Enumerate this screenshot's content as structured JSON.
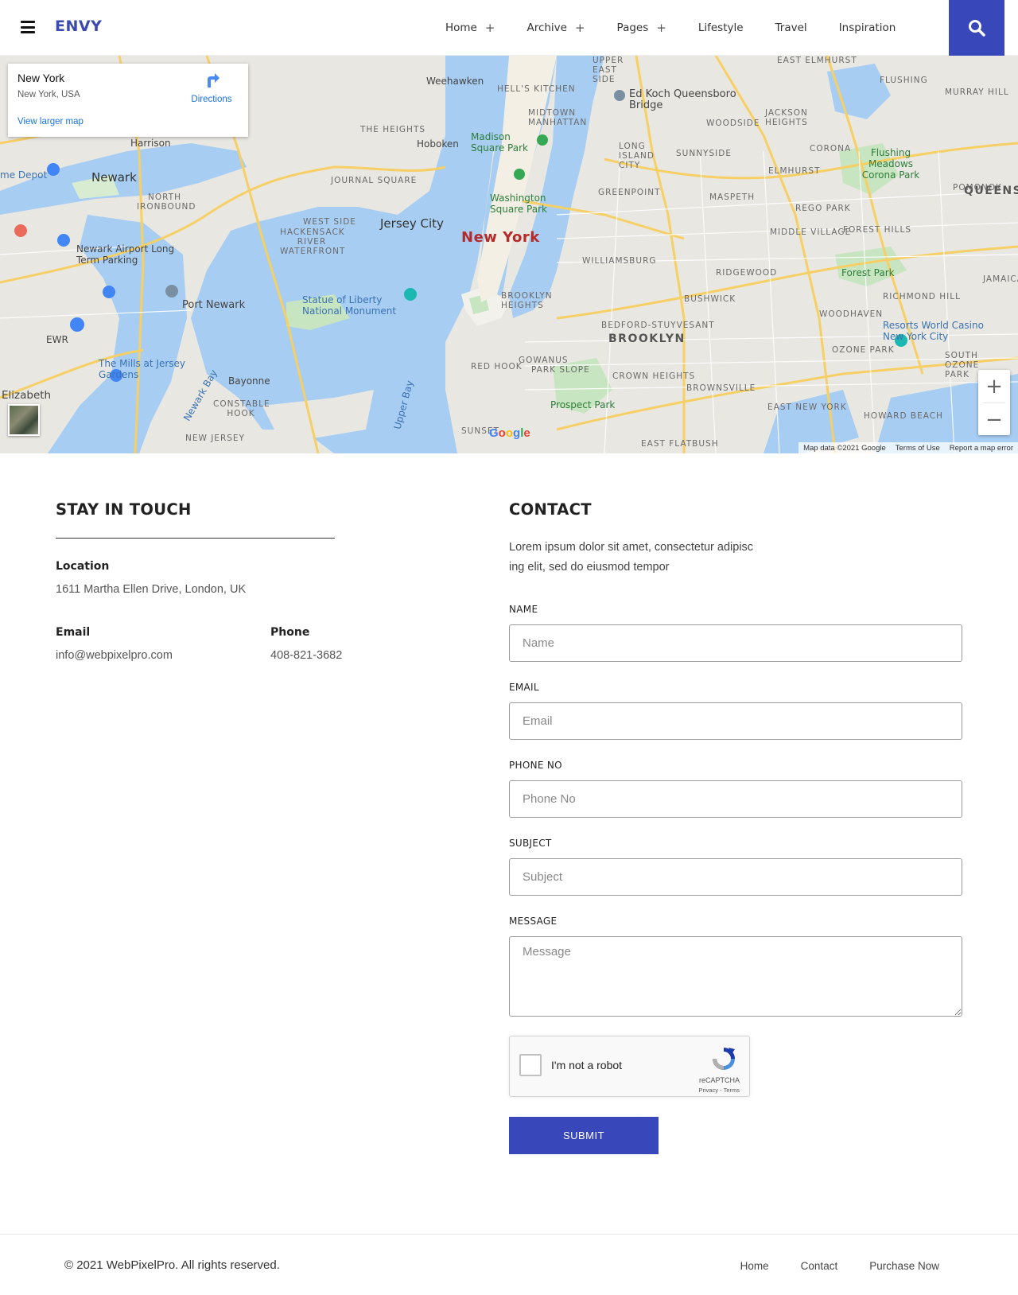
{
  "header": {
    "logo": "ENVY",
    "nav": [
      {
        "label": "Home",
        "has_sub": true,
        "plus": "+"
      },
      {
        "label": "Archive",
        "has_sub": true,
        "plus": "+"
      },
      {
        "label": "Pages",
        "has_sub": true,
        "plus": "+"
      },
      {
        "label": "Lifestyle",
        "has_sub": false
      },
      {
        "label": "Travel",
        "has_sub": false
      },
      {
        "label": "Inspiration",
        "has_sub": false
      }
    ],
    "search_icon": "search-icon",
    "accent_color": "#3847b9"
  },
  "map": {
    "place_title": "New York",
    "place_subtitle": "New York, USA",
    "view_larger": "View larger map",
    "directions": "Directions",
    "zoom_in": "+",
    "zoom_out": "−",
    "google": "Google",
    "attribution": "Map data ©2021 Google",
    "terms": "Terms of Use",
    "report": "Report a map error",
    "labels": {
      "new_york": "New York",
      "jersey_city": "Jersey City",
      "newark": "Newark",
      "brooklyn": "BROOKLYN",
      "queens": "QUEENS",
      "hoboken": "Hoboken",
      "weehawken": "Weehawken",
      "harrison": "Harrison",
      "bayonne": "Bayonne",
      "elizabeth": "Elizabeth",
      "port_newark": "Port Newark",
      "newark_airport": "Newark Airport Long Term Parking",
      "ewr": "EWR",
      "mills": "The Mills at Jersey Gardens",
      "liberty": "Statue of Liberty National Monument",
      "madison": "Madison Square Park",
      "washington": "Washington Square Park",
      "ed_koch": "Ed Koch Queensboro Bridge",
      "flushing_meadows": "Flushing Meadows Corona Park",
      "forest_park": "Forest Park",
      "prospect_park": "Prospect Park",
      "resorts": "Resorts World Casino New York City",
      "williamsburg": "WILLIAMSBURG",
      "bushwick": "BUSHWICK",
      "ridgewood": "RIDGEWOOD",
      "bedford": "BEDFORD-STUYVESANT",
      "crown_heights": "CROWN HEIGHTS",
      "brownsville": "BROWNSVILLE",
      "east_new_york": "EAST NEW YORK",
      "park_slope": "PARK SLOPE",
      "red_hook": "RED HOOK",
      "long_island_city": "LONG ISLAND CITY",
      "sunnyside": "SUNNYSIDE",
      "maspeth": "MASPETH",
      "elmhurst": "ELMHURST",
      "corona": "CORONA",
      "flushing": "FLUSHING",
      "jackson_heights": "JACKSON HEIGHTS",
      "woodside": "WOODSIDE",
      "midtown": "MIDTOWN MANHATTAN",
      "hells_kitchen": "HELL'S KITCHEN",
      "upper_east_side": "UPPER EAST SIDE",
      "the_heights": "THE HEIGHTS",
      "journal_square": "JOURNAL SQUARE",
      "west_side": "WEST SIDE",
      "hackensack": "HACKENSACK RIVER WATERFRONT",
      "north_ironbound": "NORTH IRONBOUND",
      "greenpoint": "GREENPOINT",
      "upper_bay": "Upper Bay",
      "newark_bay": "Newark Bay",
      "depot": "me Depot",
      "rego_park": "REGO PARK",
      "middle_village": "MIDDLE VILLAGE",
      "forest_hills": "FOREST HILLS",
      "woodhaven": "WOODHAVEN",
      "richmond_hill": "RICHMOND HILL",
      "ozone_park": "OZONE PARK",
      "howard_beach": "HOWARD BEACH",
      "east_flatbush": "EAST FLATBUSH",
      "murray_hill": "MURRAY HILL",
      "east_elmhurst": "EAST ELMHURST",
      "pomonok": "POMONOK",
      "jamaica": "JAMAICA",
      "constable_hook": "CONSTABLE HOOK",
      "new_jersey": "NEW JERSEY",
      "brooklyn_heights": "BROOKLYN HEIGHTS",
      "gowanus": "GOWANUS",
      "south_ozone": "SOUTH OZONE PARK",
      "sunset": "SUNSET"
    }
  },
  "stay_in_touch": {
    "title": "STAY IN TOUCH",
    "location_label": "Location",
    "location_value": "1611 Martha Ellen Drive, London, UK",
    "email_label": "Email",
    "email_value": "info@webpixelpro.com",
    "phone_label": "Phone",
    "phone_value": "408-821-3682"
  },
  "contact": {
    "title": "CONTACT",
    "description_line1": "Lorem ipsum dolor sit amet, consectetur adipisc",
    "description_line2": "ing elit, sed do eiusmod tempor",
    "fields": {
      "name_label": "NAME",
      "name_placeholder": "Name",
      "email_label": "EMAIL",
      "email_placeholder": "Email",
      "phone_label": "PHONE NO",
      "phone_placeholder": "Phone No",
      "subject_label": "SUBJECT",
      "subject_placeholder": "Subject",
      "message_label": "MESSAGE",
      "message_placeholder": "Message"
    },
    "captcha_text": "I'm not a robot",
    "captcha_brand": "reCAPTCHA",
    "captcha_terms": "Privacy - Terms",
    "submit": "SUBMIT"
  },
  "footer": {
    "copyright": "© 2021 WebPixelPro. All rights reserved.",
    "links": [
      "Home",
      "Contact",
      "Purchase Now"
    ]
  }
}
